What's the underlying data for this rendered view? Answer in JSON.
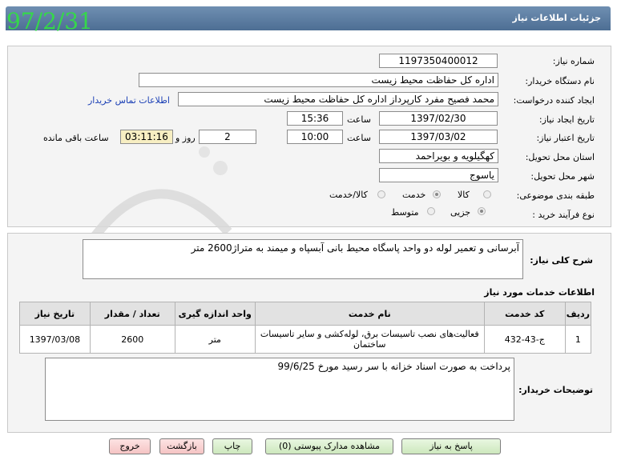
{
  "header": {
    "title": "جزئیات اطلاعات نیاز",
    "date_stamp": "97/2/31"
  },
  "form": {
    "need_number": {
      "label": "شماره نیاز:",
      "value": "1197350400012"
    },
    "buyer_org": {
      "label": "نام دستگاه خریدار:",
      "value": "اداره کل حفاظت محیط زیست"
    },
    "requester": {
      "label": "ایجاد کننده درخواست:",
      "value": "محمد فصیح مفرد کارپرداز اداره کل حفاظت محیط زیست",
      "contact_link": "اطلاعات تماس خریدار"
    },
    "created": {
      "label": "تاریخ ایجاد نیاز:",
      "date": "1397/02/30",
      "time_label": "ساعت",
      "time": "15:36"
    },
    "validity": {
      "label": "تاریخ اعتبار نیاز:",
      "date": "1397/03/02",
      "time_label": "ساعت",
      "time": "10:00",
      "days": "2",
      "days_label": "روز و",
      "remaining": "03:11:16",
      "remaining_label": "ساعت باقی مانده"
    },
    "province": {
      "label": "استان محل تحویل:",
      "value": "کهگیلویه و بویراحمد"
    },
    "city": {
      "label": "شهر محل تحویل:",
      "value": "یاسوج"
    },
    "category": {
      "label": "طبقه بندی موضوعی:",
      "options": [
        "کالا",
        "خدمت",
        "کالا/خدمت"
      ],
      "selected": "خدمت"
    },
    "purchase_type": {
      "label": "نوع فرآیند خرید :",
      "options": [
        "جزیی",
        "متوسط"
      ],
      "selected": "جزیی"
    }
  },
  "description": {
    "label": "شرح کلی نیاز:",
    "value": "آبرسانی و تعمیر لوله دو واحد پاسگاه محیط بانی آبسپاه و میمند به متراژ2600 متر"
  },
  "services": {
    "title": "اطلاعات خدمات مورد نیاز",
    "columns": [
      "ردیف",
      "کد خدمت",
      "نام خدمت",
      "واحد اندازه گیری",
      "تعداد / مقدار",
      "تاریخ نیاز"
    ],
    "rows": [
      {
        "row": "1",
        "code": "ج-43-432",
        "name": "فعالیت‌های نصب تاسیسات برق، لوله‌کشی و سایر تاسیسات ساختمان",
        "unit": "متر",
        "qty": "2600",
        "date": "1397/03/08"
      }
    ]
  },
  "buyer_notes": {
    "label": "توضیحات خریدار:",
    "value": "پرداخت به صورت اسناد خزانه با سر رسید مورخ 99/6/25"
  },
  "buttons": {
    "reply": "پاسخ به نیاز",
    "attachments": "مشاهده مدارک پیوستی (0)",
    "print": "چاپ",
    "back": "بازگشت",
    "exit": "خروج"
  },
  "colors": {
    "title_bar": "#5b7ba0",
    "date_stamp": "#35d84a",
    "link": "#1a3fb5"
  }
}
